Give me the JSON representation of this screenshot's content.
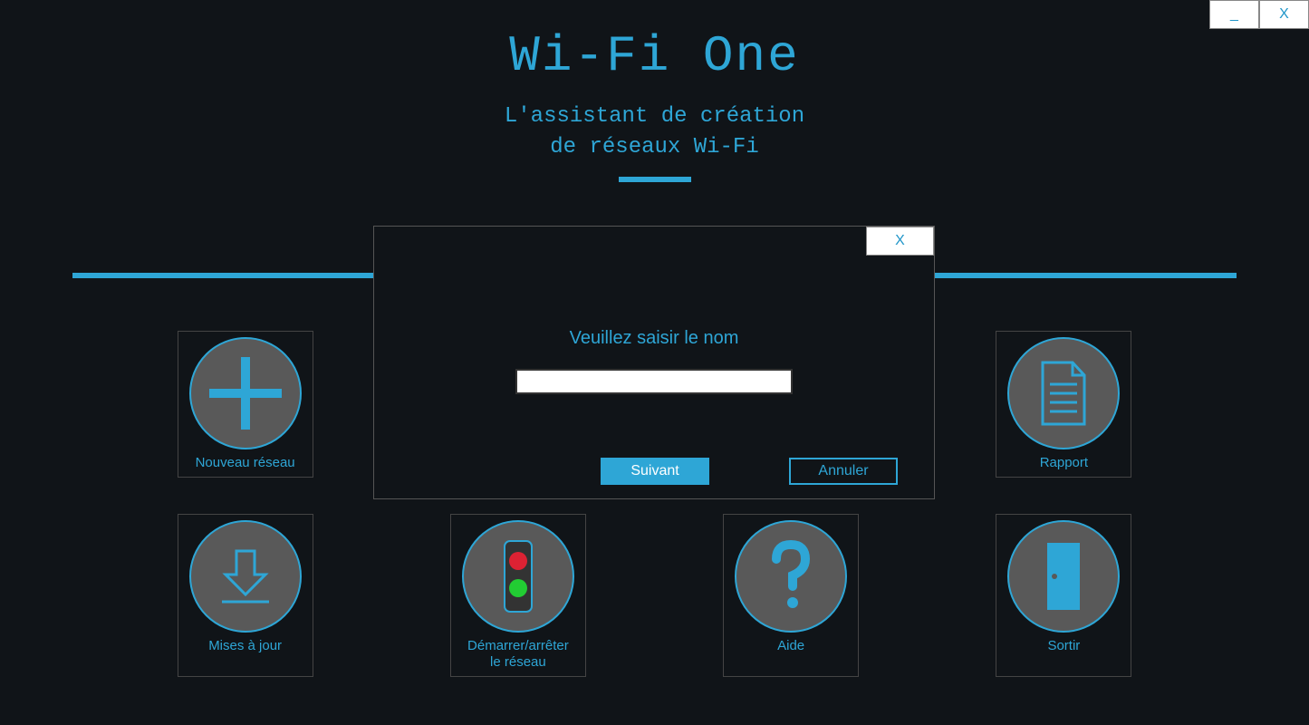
{
  "window": {
    "minimize": "_",
    "close": "X"
  },
  "header": {
    "title": "Wi-Fi One",
    "subtitle_line1": "L'assistant de création",
    "subtitle_line2": "de réseaux Wi-Fi"
  },
  "cards": {
    "new_network": "Nouveau réseau",
    "report": "Rapport",
    "updates": "Mises à jour",
    "start_stop": "Démarrer/arrêter\nle réseau",
    "help": "Aide",
    "exit": "Sortir"
  },
  "dialog": {
    "close": "X",
    "prompt": "Veuillez saisir le nom",
    "input_value": "",
    "next": "Suivant",
    "cancel": "Annuler"
  },
  "colors": {
    "accent": "#2ea6d6",
    "bg": "#101418",
    "circle": "#595959"
  }
}
